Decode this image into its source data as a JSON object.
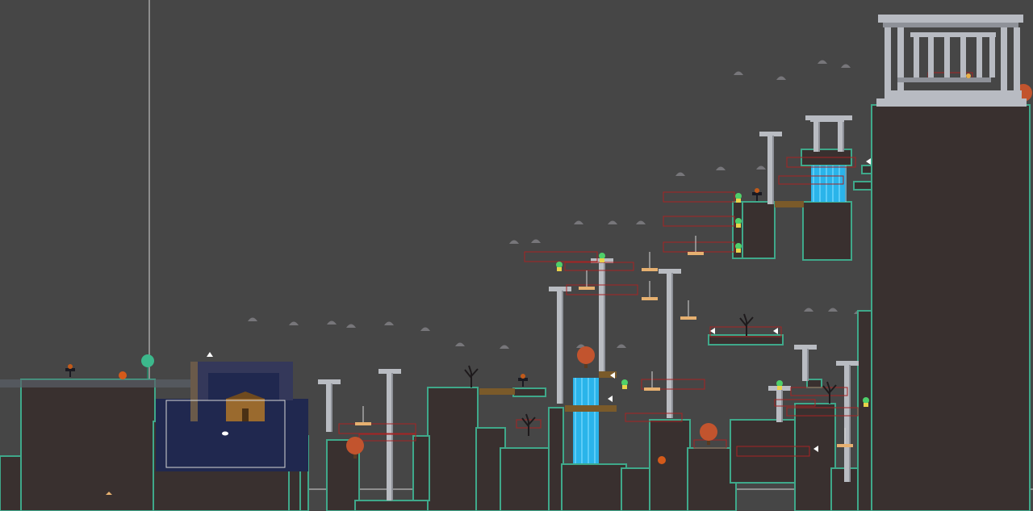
{
  "colors": {
    "background": "#464646",
    "ground_fill": "#39302f",
    "ground_edge": "#3fa88a",
    "pillar": "#b9bcc2",
    "pillar_shade": "#8e9198",
    "water": "#2ab4ea",
    "water_light": "#7fdcff",
    "night_sky": "#20284f",
    "brick": "#34385a",
    "cabin": "#9a6a2e",
    "wood": "#7a5a2a",
    "trigger_outline": "#a62424",
    "tree_autumn": "#c2542e",
    "tree_dead": "#1e1a1c",
    "stone": "#77767a",
    "guide_line": "#d6d6d6",
    "checkpoint_orb": "#3cb88c",
    "pumpkin": "#d45a1a",
    "temple": "#b8bbc2"
  },
  "editor": {
    "origin_marker": "crosshair-guide",
    "room_selection": "selection-rectangle"
  },
  "entities": {
    "pillars": 11,
    "waterfalls": 3,
    "spirits": 8,
    "pumpkins": 4,
    "dead_trees": 5,
    "autumn_trees": 4,
    "swinging_platforms": 8,
    "trigger_zones": 20,
    "floating_stones": 40
  }
}
